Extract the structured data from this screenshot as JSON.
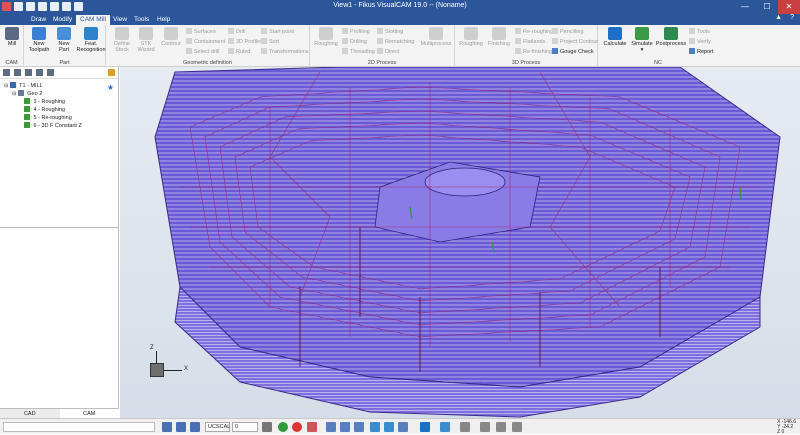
{
  "window": {
    "title": "View1 - Fikus VisualCAM 19.0 -- (Noname)",
    "controls": {
      "minimize": "—",
      "maximize": "☐",
      "close": "✕"
    }
  },
  "ribbon_tabs": [
    "Draw",
    "Modify",
    "CAM Mill",
    "View",
    "Tools",
    "Help"
  ],
  "active_tab": "CAM Mill",
  "ribbon": {
    "cam": {
      "label": "CAM",
      "mill": "Mill"
    },
    "part": {
      "label": "Part",
      "new_toolpath": [
        "New",
        "Toolpath"
      ],
      "new_part": [
        "New",
        "Part"
      ],
      "feat": [
        "Feat.",
        "Recognition"
      ]
    },
    "geometric_definition": {
      "label": "Geometric definition",
      "define_stock": [
        "Define",
        "Stock"
      ],
      "stk_wizard": [
        "STK",
        "Wizard"
      ],
      "contour": "Contour",
      "col1": [
        "Surfaces",
        "Containment",
        "Select drill"
      ],
      "col2": [
        "Drill",
        "3D Profiles",
        "Ruled"
      ],
      "col3": [
        "Start point",
        "Sort",
        "Transformations"
      ]
    },
    "process_2d": {
      "label": "2D Process",
      "roughing": "Roughing",
      "col1": [
        "Profiling",
        "Drilling",
        "Threading"
      ],
      "col2": [
        "Slotting",
        "Rematching",
        "Direct"
      ],
      "multiprocess": "Multiprocess"
    },
    "process_3d": {
      "label": "3D Process",
      "roughing": "Roughing",
      "finishing": "Finishing",
      "col1": [
        "Re-roughing",
        "Flatlands",
        "Re-finishing"
      ],
      "col2": [
        "Pencilling",
        "Project Contour",
        "Gouge Check"
      ]
    },
    "nc": {
      "label": "NC",
      "calculate": "Calculate",
      "simulate": "Simulate",
      "postprocess": "Postprocess",
      "col1": [
        "Tools",
        "Verify",
        "Report"
      ]
    }
  },
  "tree": {
    "items": [
      {
        "label": "T1 - MILL",
        "indent": 0
      },
      {
        "label": "Geo 2",
        "indent": 1
      },
      {
        "label": "3 - Roughing",
        "indent": 2
      },
      {
        "label": "4 - Roughing",
        "indent": 2
      },
      {
        "label": "5 - Re-roughing",
        "indent": 2
      },
      {
        "label": "6 - 3D F Constant Z",
        "indent": 2
      }
    ]
  },
  "bottom_tabs": [
    "CAD",
    "CAM"
  ],
  "active_bottom_tab": "CAM",
  "axes": {
    "x": "X",
    "z": "Z"
  },
  "statusbar": {
    "ucs_select": "UCSCAL",
    "value_select": "0",
    "coords": [
      "X -146.6",
      "Y -24.2",
      "Z 0"
    ]
  },
  "colors": {
    "titlebar": "#2b579a",
    "toolpath": "#a0206a",
    "model": "#6f58d8"
  }
}
